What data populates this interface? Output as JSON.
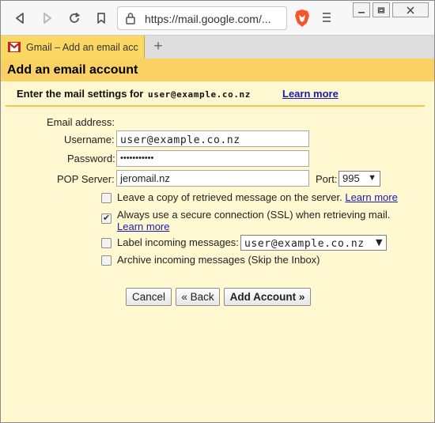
{
  "browser": {
    "url": "https://mail.google.com/...",
    "tab_title": "Gmail – Add an email account",
    "new_tab_symbol": "+"
  },
  "page": {
    "title": "Add an email account",
    "settings_label": "Enter the mail settings for",
    "settings_email": "user@example.co.nz",
    "learn_more": "Learn more"
  },
  "form": {
    "email_address_label": "Email address:",
    "username_label": "Username:",
    "username_value": "user@example.co.nz",
    "password_label": "Password:",
    "password_value": "•••••••••••",
    "pop_server_label": "POP Server:",
    "pop_server_value": "jeromail.nz",
    "port_label": "Port:",
    "port_value": "995"
  },
  "options": {
    "leave_copy": {
      "label": "Leave a copy of retrieved message on the server.",
      "link": "Learn more",
      "checked": false
    },
    "ssl": {
      "label": "Always use a secure connection (SSL) when retrieving mail.",
      "link": "Learn more",
      "checked": true
    },
    "label_incoming": {
      "label": "Label incoming messages:",
      "value": "user@example.co.nz",
      "checked": false
    },
    "archive": {
      "label": "Archive incoming messages (Skip the Inbox)",
      "checked": false
    }
  },
  "buttons": {
    "cancel": "Cancel",
    "back": "« Back",
    "add_account": "Add Account »"
  },
  "colors": {
    "page_background": "#fff8d0",
    "title_bar": "#fad163",
    "link": "#1a1ab5"
  }
}
